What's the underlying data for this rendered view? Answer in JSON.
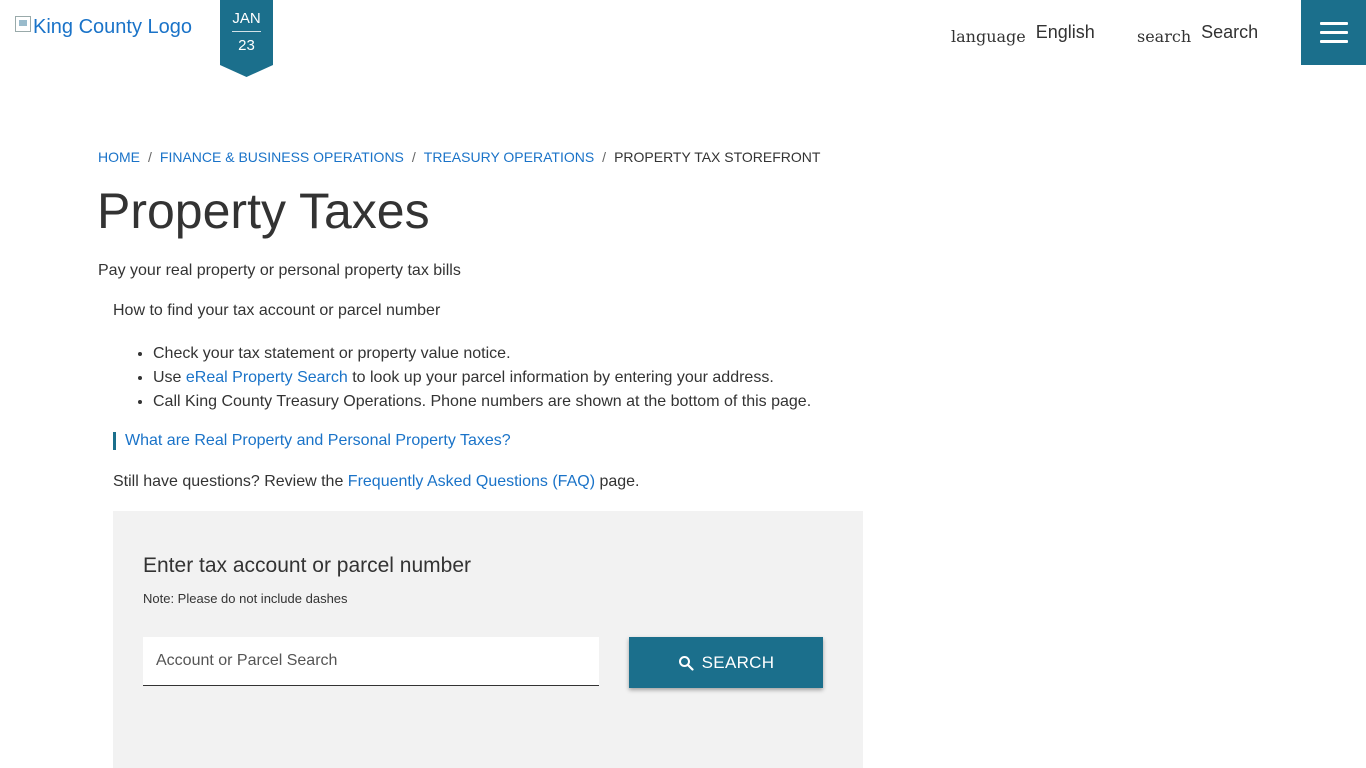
{
  "header": {
    "logo_alt": "King County Logo",
    "date_month": "JAN",
    "date_day": "23",
    "language_glyph": "language",
    "language_label": "English",
    "search_glyph": "search",
    "search_label": "Search",
    "menu_icon": "hamburger-menu-icon",
    "accent_color": "#1b6f8c"
  },
  "breadcrumb": [
    {
      "label": "HOME"
    },
    {
      "label": "FINANCE & BUSINESS OPERATIONS"
    },
    {
      "label": "TREASURY OPERATIONS"
    },
    {
      "label": "PROPERTY TAX STOREFRONT"
    }
  ],
  "page": {
    "title": "Property Taxes",
    "intro": "Pay your real property or personal property tax bills",
    "howto_heading": "How to find your tax account or parcel number",
    "tips": {
      "tip1": "Check your tax statement or property value notice.",
      "tip2_prefix": "Use ",
      "tip2_link": "eReal Property Search",
      "tip2_suffix": " to look up your parcel information by entering your address.",
      "tip3": "Call King County Treasury Operations. Phone numbers are shown at the bottom of this page."
    },
    "callout_link": "What are Real Property and Personal Property Taxes?",
    "faq_prefix": "Still have questions? Review the ",
    "faq_link": "Frequently Asked Questions (FAQ)",
    "faq_suffix": " page."
  },
  "search_panel": {
    "title": "Enter tax account or parcel number",
    "note": "Note: Please do not include dashes",
    "input_placeholder": "Account or Parcel Search",
    "input_value": "",
    "button_label": "SEARCH",
    "button_icon": "search-icon"
  }
}
